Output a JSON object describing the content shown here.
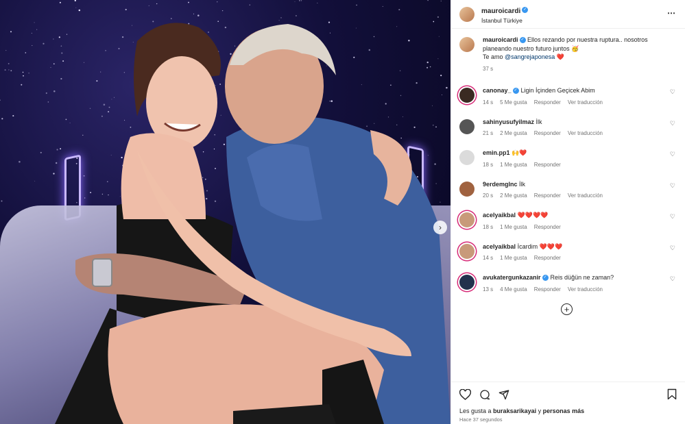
{
  "post": {
    "username": "mauroicardi",
    "location": "İstanbul Türkiye",
    "caption_user": "mauroicardi",
    "caption_line1": "Ellos rezando por nuestra ruptura.. nosotros",
    "caption_line2": "planeando nuestro futuro juntos 🥳",
    "caption_line3_prefix": "Te amo",
    "caption_mention": "@sangrejaponesa",
    "caption_line3_suffix": "❤️",
    "caption_time": "37 s"
  },
  "comments": [
    {
      "user": "canonay_",
      "verified": true,
      "text": "Ligin İçinden Geçicek Abim",
      "time": "14 s",
      "likes": "5 Me gusta",
      "reply": "Responder",
      "translate": "Ver traducción"
    },
    {
      "user": "sahinyusufyilmaz",
      "verified": false,
      "text": "İlk",
      "time": "21 s",
      "likes": "2 Me gusta",
      "reply": "Responder",
      "translate": "Ver traducción"
    },
    {
      "user": "emin.pp1",
      "verified": false,
      "text": "🙌❤️",
      "time": "18 s",
      "likes": "1 Me gusta",
      "reply": "Responder",
      "translate": ""
    },
    {
      "user": "9erdemglnc",
      "verified": false,
      "text": "İlk",
      "time": "20 s",
      "likes": "2 Me gusta",
      "reply": "Responder",
      "translate": "Ver traducción"
    },
    {
      "user": "acelyaikbal",
      "verified": false,
      "text": "❤️❤️❤️❤️",
      "time": "18 s",
      "likes": "1 Me gusta",
      "reply": "Responder",
      "translate": ""
    },
    {
      "user": "acelyaikbal",
      "verified": false,
      "text": "İcardim ❤️❤️❤️",
      "time": "14 s",
      "likes": "1 Me gusta",
      "reply": "Responder",
      "translate": ""
    },
    {
      "user": "avukatergunkazanir",
      "verified": true,
      "text": "Reis düğün ne zaman?",
      "time": "13 s",
      "likes": "4 Me gusta",
      "reply": "Responder",
      "translate": "Ver traducción"
    }
  ],
  "footer": {
    "likes_prefix": "Les gusta a",
    "likes_user": "buraksarikayai",
    "likes_suffix": "y",
    "likes_more": "personas más",
    "time": "Hace 37 segundos"
  },
  "icons": {
    "more": "⋯",
    "heart": "♡",
    "add": "+",
    "next": "›"
  },
  "colors": {
    "verified": "#3897f0",
    "story_ring": "#d62976",
    "mention": "#00376b",
    "meta": "#737373"
  }
}
